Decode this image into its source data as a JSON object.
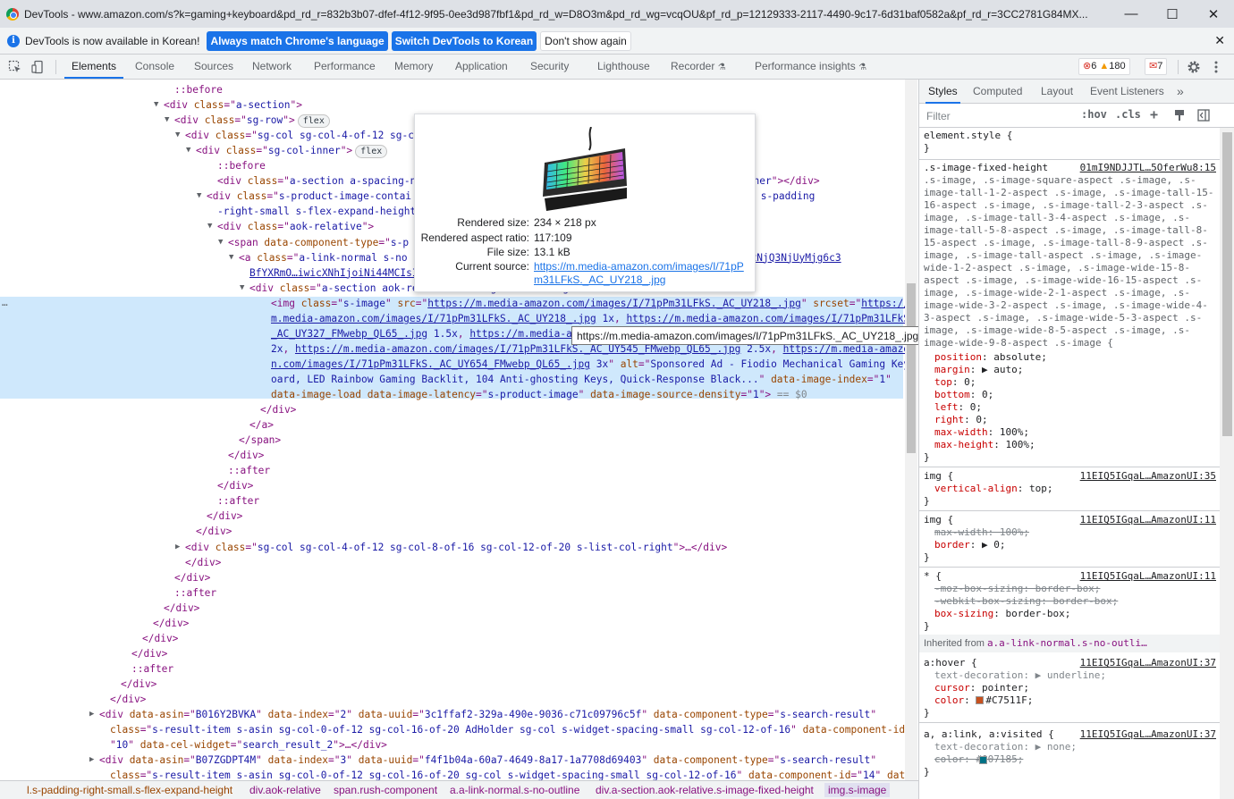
{
  "window": {
    "title": "DevTools - www.amazon.com/s?k=gaming+keyboard&pd_rd_r=832b3b07-dfef-4f12-9f95-0ee3d987fbf1&pd_rd_w=D8O3m&pd_rd_wg=vcqOU&pf_rd_p=12129333-2117-4490-9c17-6d31baf0582a&pf_rd_r=3CC2781G84MX...",
    "minimize": "—",
    "maximize": "☐",
    "close": "✕"
  },
  "infobar": {
    "message": "DevTools is now available in Korean!",
    "btn_match": "Always match Chrome's language",
    "btn_switch": "Switch DevTools to Korean",
    "btn_dismiss": "Don't show again",
    "close": "✕"
  },
  "toolbar": {
    "tabs": [
      "Elements",
      "Console",
      "Sources",
      "Network",
      "Performance",
      "Memory",
      "Application",
      "Security",
      "Lighthouse",
      "Recorder",
      "Performance insights"
    ],
    "errors": "6",
    "warnings": "180",
    "issues": "7"
  },
  "dom": {
    "lines": [
      {
        "html": "<span class='pseudo'>::before</span>"
      },
      {
        "tri": "▼",
        "html": "&lt;div <span class='attr'>class</span>=\"<span class='val'>a-section</span>\"&gt;"
      },
      {
        "tri": "▼",
        "html": "&lt;div <span class='attr'>class</span>=\"<span class='val'>sg-row</span>\"&gt;<span class='flexbadge'>flex</span>"
      },
      {
        "tri": "▼",
        "html": "&lt;div <span class='attr'>class</span>=\"<span class='val'>sg-col sg-col-4-of-12 sg-c</span>"
      },
      {
        "tri": "▼",
        "html": "&lt;div <span class='attr'>class</span>=\"<span class='val'>sg-col-inner</span>\"&gt;<span class='flexbadge'>flex</span>"
      },
      {
        "html": "<span class='pseudo'>::before</span>"
      },
      {
        "html": "&lt;div <span class='attr'>class</span>=\"<span class='val'>a-section a-spacing-no</span>                                          <span class='val'>-badge-container</span>\"&gt;&lt;/div&gt;"
      },
      {
        "tri": "▼",
        "html": "&lt;div <span class='attr'>class</span>=\"<span class='val'>s-product-image-contai</span>                                          <span class='val'>ding-left-small s-padding</span>"
      },
      {
        "html": "<span class='val'>-right-small s-flex-expand-height</span>\""
      },
      {
        "tri": "▼",
        "html": "&lt;div <span class='attr'>class</span>=\"<span class='val'>aok-relative</span>\"&gt;"
      },
      {
        "tri": "▼",
        "html": "&lt;span <span class='attr'>data-component-type</span>=\"<span class='val'>s-p</span>                                          &gt;"
      },
      {
        "tri": "▼",
        "html": "&lt;a <span class='attr'>class</span>=\"<span class='val'>a-link-normal s-no</span>                                                <span class='lnk'>c5Njk3OjE2NjQ3NjUyMjg6c3</span>"
      },
      {
        "html": "<span class='lnk'>BfYXRmO…iwicXNhIjoiNi44MCIsI</span>"
      },
      {
        "tri": "▼",
        "html": "&lt;div <span class='attr'>class</span>=\"<span class='val'>a-section aok-relative s-image-fixed-height</span>\""
      },
      {
        "sel": true,
        "html": "&lt;img <span class='attr'>class</span>=\"<span class='val'>s-image</span>\" <span class='attr'>src</span>=\"<span class='lnk'>https://m.media-amazon.com/images/I/71pPm31LFkS._AC_UY218_.jpg</span>\" <span class='attr'>srcset</span>=\"<span class='lnk'>https://</span>"
      },
      {
        "sel": true,
        "html": "<span class='lnk'>m.media-amazon.com/images/I/71pPm31LFkS._AC_UY218_.jpg</span> <span class='val'>1x</span>, <span class='lnk'>https://m.media-amazon.com/images/I/71pPm31LFkS.</span>"
      },
      {
        "sel": true,
        "html": "<span class='lnk'>_AC_UY327_FMwebp_QL65_.jpg</span> <span class='val'>1.5x</span>, <span class='lnk'>https://m.media-am</span>"
      },
      {
        "sel": true,
        "html": "<span class='val'>2x</span>, <span class='lnk'>https://m.media-amazon.com/images/I/71pPm31LFkS._AC_UY545_FMwebp_QL65_.jpg</span> <span class='val'>2.5x</span>, <span class='lnk'>https://m.media-amazo</span>"
      },
      {
        "sel": true,
        "html": "<span class='lnk'>n.com/images/I/71pPm31LFkS._AC_UY654_FMwebp_QL65_.jpg</span> <span class='val'>3x</span>\" <span class='attr'>alt</span>=\"<span class='val'>Sponsored Ad - Fiodio Mechanical Gaming Keyb</span>"
      },
      {
        "sel": true,
        "html": "<span class='val'>oard, LED Rainbow Gaming Backlit, 104 Anti-ghosting Keys, Quick-Response Black...</span>\" <span class='attr'>data-image-index</span>=\"<span class='val'>1</span>\""
      },
      {
        "sel": true,
        "html": "<span class='attr'>data-image-load</span> <span class='attr'>data-image-latency</span>=\"<span class='val'>s-product-image</span>\" <span class='attr'>data-image-source-density</span>=\"<span class='val'>1</span>\"&gt; <span class='cmt'>== $0</span>"
      },
      {
        "html": "&lt;/div&gt;"
      },
      {
        "html": "&lt;/a&gt;"
      },
      {
        "html": "&lt;/span&gt;"
      },
      {
        "html": "&lt;/div&gt;"
      },
      {
        "html": "<span class='pseudo'>::after</span>"
      },
      {
        "html": "&lt;/div&gt;"
      },
      {
        "html": "<span class='pseudo'>::after</span>"
      },
      {
        "html": "&lt;/div&gt;"
      },
      {
        "html": "&lt;/div&gt;"
      },
      {
        "tri": "▶",
        "html": "&lt;div <span class='attr'>class</span>=\"<span class='val'>sg-col sg-col-4-of-12 sg-col-8-of-16 sg-col-12-of-20 s-list-col-right</span>\"&gt;…&lt;/div&gt;"
      },
      {
        "html": "&lt;/div&gt;"
      },
      {
        "html": "&lt;/div&gt;"
      },
      {
        "html": "<span class='pseudo'>::after</span>"
      },
      {
        "html": "&lt;/div&gt;"
      },
      {
        "html": "&lt;/div&gt;"
      },
      {
        "html": "&lt;/div&gt;"
      },
      {
        "html": "&lt;/div&gt;"
      },
      {
        "html": "<span class='pseudo'>::after</span>"
      },
      {
        "html": "&lt;/div&gt;"
      },
      {
        "html": "&lt;/div&gt;"
      },
      {
        "tri": "▶",
        "html": "&lt;div <span class='attr'>data-asin</span>=\"<span class='val'>B016Y2BVKA</span>\" <span class='attr'>data-index</span>=\"<span class='val'>2</span>\" <span class='attr'>data-uuid</span>=\"<span class='val'>3c1ffaf2-329a-490e-9036-c71c09796c5f</span>\" <span class='attr'>data-component-type</span>=\"<span class='val'>s-search-result</span>\""
      },
      {
        "html": "<span class='attr'>class</span>=\"<span class='val'>s-result-item s-asin sg-col-0-of-12 sg-col-16-of-20 AdHolder sg-col s-widget-spacing-small sg-col-12-of-16</span>\" <span class='attr'>data-component-id</span>="
      },
      {
        "html": "\"<span class='val'>10</span>\" <span class='attr'>data-cel-widget</span>=\"<span class='val'>search_result_2</span>\"&gt;…&lt;/div&gt;"
      },
      {
        "tri": "▶",
        "html": "&lt;div <span class='attr'>data-asin</span>=\"<span class='val'>B07ZGDPT4M</span>\" <span class='attr'>data-index</span>=\"<span class='val'>3</span>\" <span class='attr'>data-uuid</span>=\"<span class='val'>f4f1b04a-60a7-4649-8a17-1a7708d69403</span>\" <span class='attr'>data-component-type</span>=\"<span class='val'>s-search-result</span>\""
      },
      {
        "html": "<span class='attr'>class</span>=\"<span class='val'>s-result-item s-asin sg-col-0-of-12 sg-col-16-of-20 sg-col s-widget-spacing-small sg-col-12-of-16</span>\" <span class='attr'>data-component-id</span>=\"<span class='val'>14</span>\" <span class='attr'>data-</span>"
      }
    ],
    "ellipsis": "…"
  },
  "preview": {
    "rendered_size_label": "Rendered size:",
    "rendered_size": "234 × 218 px",
    "aspect_label": "Rendered aspect ratio:",
    "aspect": "117:109",
    "file_size_label": "File size:",
    "file_size": "13.1 kB",
    "source_label": "Current source:",
    "source_line1": "https://m.media-amazon.com/images/I/71pP",
    "source_line2": "m31LFkS._AC_UY218_.jpg"
  },
  "tooltip": "https://m.media-amazon.com/images/I/71pPm31LFkS._AC_UY218_.jpg",
  "breadcrumbs": [
    "l.s-padding-right-small.s-flex-expand-height",
    "div.aok-relative",
    "span.rush-component",
    "a.a-link-normal.s-no-outline",
    "div.a-section.aok-relative.s-image-fixed-height",
    "img.s-image"
  ],
  "styles": {
    "tabs": [
      "Styles",
      "Computed",
      "Layout",
      "Event Listeners"
    ],
    "more": "»",
    "filter_placeholder": "Filter",
    "hov": ":hov",
    "cls": ".cls",
    "plus": "+",
    "element_style": "element.style {",
    "close_brace": "}",
    "rule1_source": "01mI9NDJJTL…5OferWu8:15",
    "rule1_selector_lines": [
      ".s-image-fixed-height",
      ".s-image, .s-image-square-aspect .s-image, .s-",
      "image-tall-1-2-aspect .s-image, .s-image-tall-15-",
      "16-aspect .s-image, .s-image-tall-2-3-aspect .s-",
      "image, .s-image-tall-3-4-aspect .s-image, .s-",
      "image-tall-5-8-aspect .s-image, .s-image-tall-8-",
      "15-aspect .s-image, .s-image-tall-8-9-aspect .s-",
      "image, .s-image-tall-aspect .s-image, .s-image-",
      "wide-1-2-aspect .s-image, .s-image-wide-15-8-",
      "aspect .s-image, .s-image-wide-16-15-aspect .s-",
      "image, .s-image-wide-2-1-aspect .s-image, .s-",
      "image-wide-3-2-aspect .s-image, .s-image-wide-4-",
      "3-aspect .s-image, .s-image-wide-5-3-aspect .s-",
      "image, .s-image-wide-8-5-aspect .s-image, .s-",
      "image-wide-9-8-aspect .s-image {"
    ],
    "rule1_props": [
      [
        "position",
        "absolute;"
      ],
      [
        "margin",
        "▶ auto;"
      ],
      [
        "top",
        "0;"
      ],
      [
        "bottom",
        "0;"
      ],
      [
        "left",
        "0;"
      ],
      [
        "right",
        "0;"
      ],
      [
        "max-width",
        "100%;"
      ],
      [
        "max-height",
        "100%;"
      ]
    ],
    "rule2_selector": "img {",
    "rule2_source": "11EIQ5IGqaL…AmazonUI:35",
    "rule2_prop": "vertical-align",
    "rule2_val": "top;",
    "rule3_selector": "img {",
    "rule3_source": "11EIQ5IGqaL…AmazonUI:11",
    "rule3_prop1": "max-width: 100%;",
    "rule3_prop2": "border",
    "rule3_val2": "▶ 0;",
    "rule4_selector": "* {",
    "rule4_source": "11EIQ5IGqaL…AmazonUI:11",
    "rule4_prop1": "-moz-box-sizing: border-box;",
    "rule4_prop2": "-webkit-box-sizing: border-box;",
    "rule4_prop3": "box-sizing",
    "rule4_val3": "border-box;",
    "inherited_label": "Inherited from",
    "inherited_from": "a.a-link-normal.s-no-outli…",
    "rule5_selector": "a:hover {",
    "rule5_source": "11EIQ5IGqaL…AmazonUI:37",
    "rule5_prop1": "text-decoration: ▶ underline;",
    "rule5_prop2": "cursor",
    "rule5_val2": "pointer;",
    "rule5_prop3": "color",
    "rule5_val3": "#C7511F;",
    "rule5_color": "#C7511F",
    "rule6_selector": "a, a:link, a:visited {",
    "rule6_source": "11EIQ5IGqaL…AmazonUI:37",
    "rule6_prop1": "text-decoration: ▶ none;",
    "rule6_prop2": "color: #007185;",
    "rule6_color": "#007185"
  },
  "colors": {
    "accent": "#1a73e8",
    "selection": "#cfe8fc",
    "tag": "#881280",
    "attr_name": "#994500",
    "attr_value": "#1a1aa6"
  }
}
